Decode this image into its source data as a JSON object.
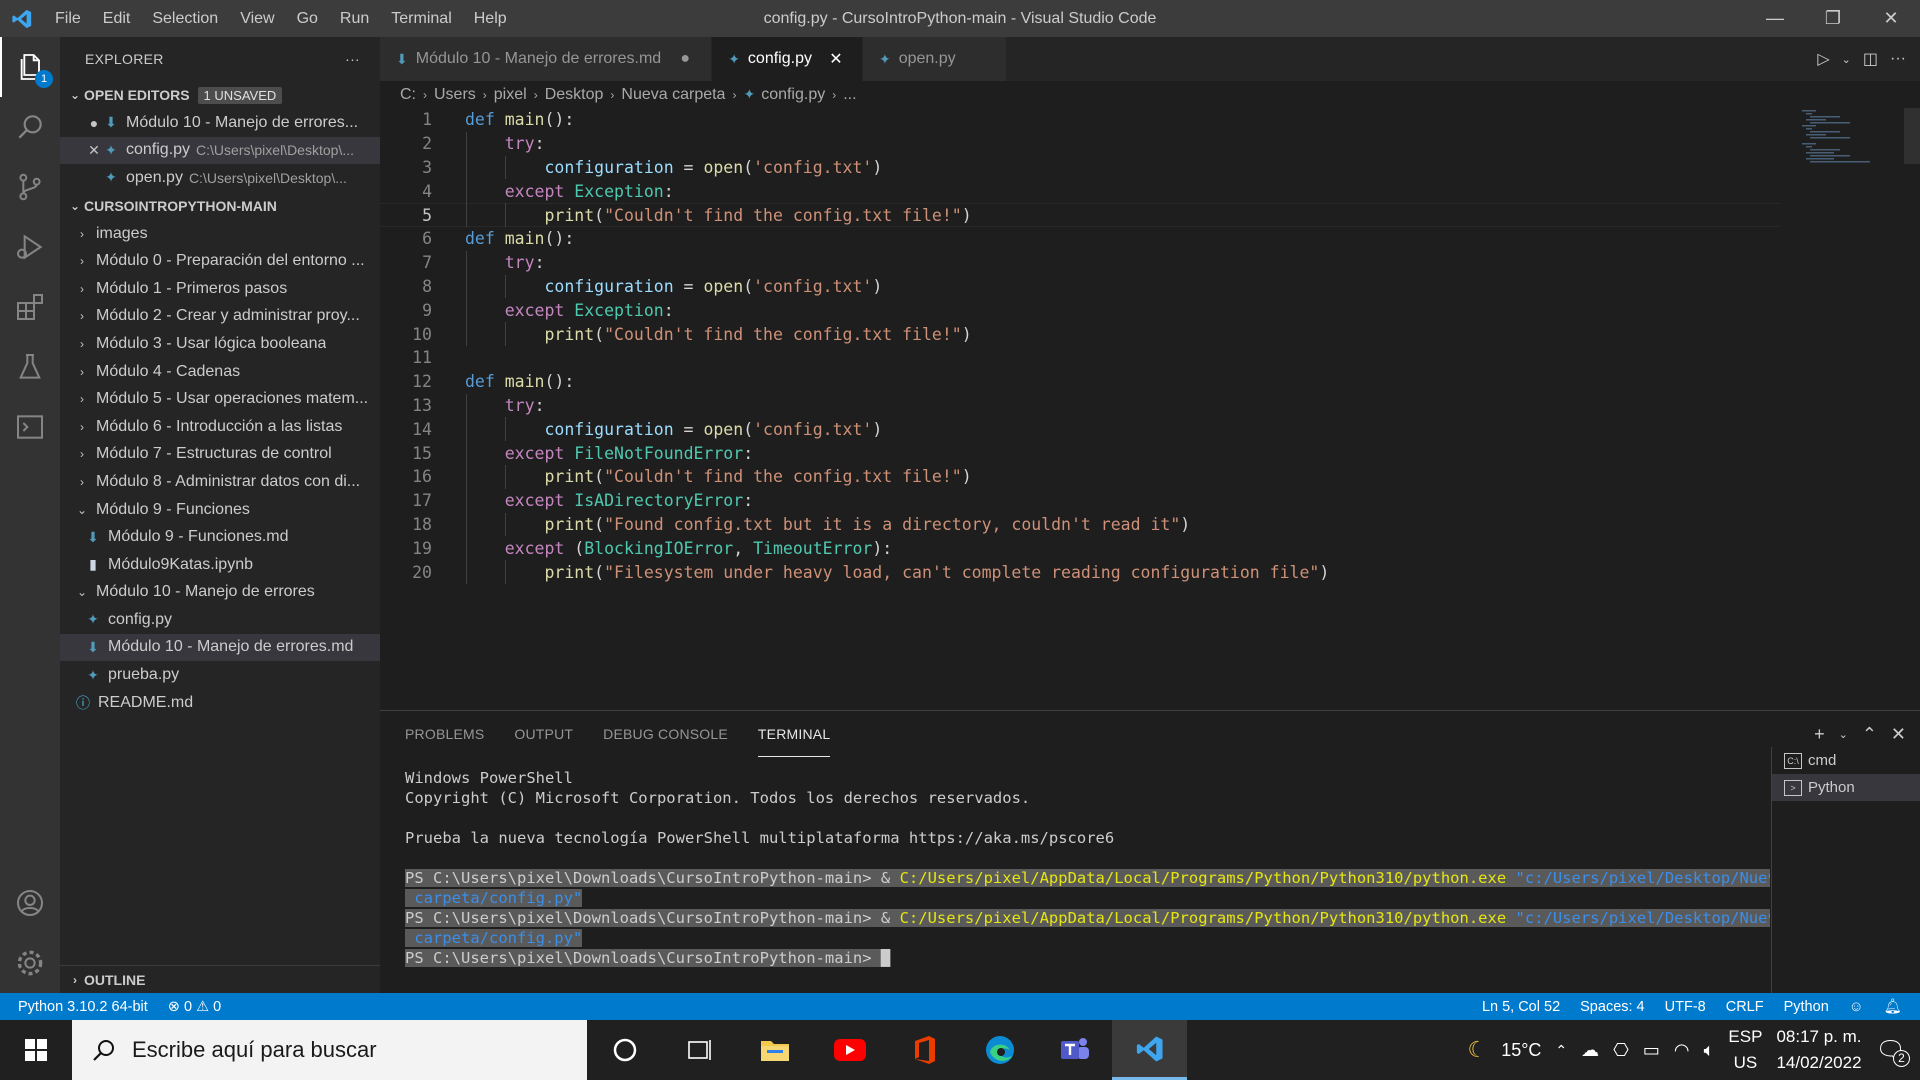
{
  "window": {
    "title": "config.py - CursoIntroPython-main - Visual Studio Code",
    "menu": [
      "File",
      "Edit",
      "Selection",
      "View",
      "Go",
      "Run",
      "Terminal",
      "Help"
    ],
    "controls": {
      "minimize": "—",
      "restore": "❐",
      "close": "✕"
    }
  },
  "activity": {
    "explorer_badge": "1"
  },
  "sidebar": {
    "header": "EXPLORER",
    "header_more": "···",
    "open_editors": {
      "label": "OPEN EDITORS",
      "badge": "1 UNSAVED",
      "items": [
        {
          "marker": "●",
          "name": "Módulo 10 - Manejo de errores...",
          "path": "",
          "icon": "markdown-icon"
        },
        {
          "marker": "✕",
          "name": "config.py",
          "path": "C:\\Users\\pixel\\Desktop\\...",
          "icon": "python-icon"
        },
        {
          "marker": "",
          "name": "open.py",
          "path": "C:\\Users\\pixel\\Desktop\\...",
          "icon": "python-icon"
        }
      ]
    },
    "project": {
      "label": "CURSOINTROPYTHON-MAIN",
      "items": [
        {
          "type": "folder",
          "depth": 0,
          "open": false,
          "name": "images"
        },
        {
          "type": "folder",
          "depth": 0,
          "open": false,
          "name": "Módulo 0 - Preparación del entorno ..."
        },
        {
          "type": "folder",
          "depth": 0,
          "open": false,
          "name": "Módulo 1 - Primeros pasos"
        },
        {
          "type": "folder",
          "depth": 0,
          "open": false,
          "name": "Módulo 2 - Crear y administrar proy..."
        },
        {
          "type": "folder",
          "depth": 0,
          "open": false,
          "name": "Módulo 3 - Usar lógica booleana"
        },
        {
          "type": "folder",
          "depth": 0,
          "open": false,
          "name": "Módulo 4 - Cadenas"
        },
        {
          "type": "folder",
          "depth": 0,
          "open": false,
          "name": "Módulo 5 - Usar operaciones matem..."
        },
        {
          "type": "folder",
          "depth": 0,
          "open": false,
          "name": "Módulo 6 - Introducción a las listas"
        },
        {
          "type": "folder",
          "depth": 0,
          "open": false,
          "name": "Módulo 7 - Estructuras de control"
        },
        {
          "type": "folder",
          "depth": 0,
          "open": false,
          "name": "Módulo 8 - Administrar datos con di..."
        },
        {
          "type": "folder",
          "depth": 0,
          "open": true,
          "name": "Módulo 9 - Funciones"
        },
        {
          "type": "md",
          "depth": 1,
          "name": "Módulo 9 - Funciones.md"
        },
        {
          "type": "nb",
          "depth": 1,
          "name": "Módulo9Katas.ipynb"
        },
        {
          "type": "folder",
          "depth": 0,
          "open": true,
          "name": "Módulo 10 - Manejo de errores"
        },
        {
          "type": "py",
          "depth": 1,
          "name": "config.py"
        },
        {
          "type": "md",
          "depth": 1,
          "name": "Módulo 10 - Manejo de errores.md",
          "selected": true
        },
        {
          "type": "py",
          "depth": 1,
          "name": "prueba.py"
        },
        {
          "type": "info",
          "depth": 0,
          "name": "README.md"
        }
      ]
    },
    "outline_label": "OUTLINE"
  },
  "tabs": [
    {
      "name": "Módulo 10 - Manejo de errores.md",
      "icon": "markdown-icon",
      "ctl": "●",
      "active": false
    },
    {
      "name": "config.py",
      "icon": "python-icon",
      "ctl": "✕",
      "active": true
    },
    {
      "name": "open.py",
      "icon": "python-icon",
      "ctl": "",
      "active": false
    }
  ],
  "breadcrumb": [
    "C:",
    "Users",
    "pixel",
    "Desktop",
    "Nueva carpeta",
    "config.py",
    "..."
  ],
  "editor": {
    "current_line": 5,
    "lines": [
      [
        [
          "kwd",
          "def "
        ],
        [
          "fn",
          "main"
        ],
        [
          "",
          "():"
        ]
      ],
      [
        [
          "",
          "    "
        ],
        [
          "kw",
          "try"
        ],
        [
          "",
          ":"
        ]
      ],
      [
        [
          "",
          "        "
        ],
        [
          "var",
          "configuration"
        ],
        [
          "",
          " = "
        ],
        [
          "fn",
          "open"
        ],
        [
          "",
          "("
        ],
        [
          "str",
          "'config.txt'"
        ],
        [
          "",
          ")"
        ]
      ],
      [
        [
          "",
          "    "
        ],
        [
          "kw",
          "except "
        ],
        [
          "cls",
          "Exception"
        ],
        [
          "",
          ":"
        ]
      ],
      [
        [
          "",
          "        "
        ],
        [
          "fn",
          "print"
        ],
        [
          "",
          "("
        ],
        [
          "str",
          "\"Couldn't find the config.txt file!\""
        ],
        [
          "",
          ")"
        ]
      ],
      [
        [
          "kwd",
          "def "
        ],
        [
          "fn",
          "main"
        ],
        [
          "",
          "():"
        ]
      ],
      [
        [
          "",
          "    "
        ],
        [
          "kw",
          "try"
        ],
        [
          "",
          ":"
        ]
      ],
      [
        [
          "",
          "        "
        ],
        [
          "var",
          "configuration"
        ],
        [
          "",
          " = "
        ],
        [
          "fn",
          "open"
        ],
        [
          "",
          "("
        ],
        [
          "str",
          "'config.txt'"
        ],
        [
          "",
          ")"
        ]
      ],
      [
        [
          "",
          "    "
        ],
        [
          "kw",
          "except "
        ],
        [
          "cls",
          "Exception"
        ],
        [
          "",
          ":"
        ]
      ],
      [
        [
          "",
          "        "
        ],
        [
          "fn",
          "print"
        ],
        [
          "",
          "("
        ],
        [
          "str",
          "\"Couldn't find the config.txt file!\""
        ],
        [
          "",
          ")"
        ]
      ],
      [],
      [
        [
          "kwd",
          "def "
        ],
        [
          "fn",
          "main"
        ],
        [
          "",
          "():"
        ]
      ],
      [
        [
          "",
          "    "
        ],
        [
          "kw",
          "try"
        ],
        [
          "",
          ":"
        ]
      ],
      [
        [
          "",
          "        "
        ],
        [
          "var",
          "configuration"
        ],
        [
          "",
          " = "
        ],
        [
          "fn",
          "open"
        ],
        [
          "",
          "("
        ],
        [
          "str",
          "'config.txt'"
        ],
        [
          "",
          ")"
        ]
      ],
      [
        [
          "",
          "    "
        ],
        [
          "kw",
          "except "
        ],
        [
          "cls",
          "FileNotFoundError"
        ],
        [
          "",
          ":"
        ]
      ],
      [
        [
          "",
          "        "
        ],
        [
          "fn",
          "print"
        ],
        [
          "",
          "("
        ],
        [
          "str",
          "\"Couldn't find the config.txt file!\""
        ],
        [
          "",
          ")"
        ]
      ],
      [
        [
          "",
          "    "
        ],
        [
          "kw",
          "except "
        ],
        [
          "cls",
          "IsADirectoryError"
        ],
        [
          "",
          ":"
        ]
      ],
      [
        [
          "",
          "        "
        ],
        [
          "fn",
          "print"
        ],
        [
          "",
          "("
        ],
        [
          "str",
          "\"Found config.txt but it is a directory, couldn't read it\""
        ],
        [
          "",
          ")"
        ]
      ],
      [
        [
          "",
          "    "
        ],
        [
          "kw",
          "except "
        ],
        [
          "",
          "("
        ],
        [
          "cls",
          "BlockingIOError"
        ],
        [
          "",
          ", "
        ],
        [
          "cls",
          "TimeoutError"
        ],
        [
          "",
          "):"
        ]
      ],
      [
        [
          "",
          "        "
        ],
        [
          "fn",
          "print"
        ],
        [
          "",
          "("
        ],
        [
          "str",
          "\"Filesystem under heavy load, can't complete reading configuration file\""
        ],
        [
          "",
          ")"
        ]
      ]
    ]
  },
  "panel": {
    "tabs": [
      "PROBLEMS",
      "OUTPUT",
      "DEBUG CONSOLE",
      "TERMINAL"
    ],
    "active_tab": "TERMINAL",
    "terminal_lines": [
      [
        [
          "",
          "Windows PowerShell"
        ]
      ],
      [
        [
          "",
          "Copyright (C) Microsoft Corporation. Todos los derechos reservados."
        ]
      ],
      [
        [
          "",
          ""
        ]
      ],
      [
        [
          "",
          "Prueba la nueva tecnología PowerShell multiplataforma https://aka.ms/pscore6"
        ]
      ],
      [
        [
          "",
          ""
        ]
      ],
      [
        [
          "s",
          "PS C:\\Users\\pixel\\Downloads\\CursoIntroPython-main> & "
        ],
        [
          "sy",
          "C:/Users/pixel/AppData/Local/Programs/Python/Python310/python.exe"
        ],
        [
          "s",
          " "
        ],
        [
          "sc",
          "\"c:/Users/pixel/Desktop/Nueva"
        ]
      ],
      [
        [
          "sc",
          " carpeta/config.py\""
        ]
      ],
      [
        [
          "s",
          "PS C:\\Users\\pixel\\Downloads\\CursoIntroPython-main> & "
        ],
        [
          "sy",
          "C:/Users/pixel/AppData/Local/Programs/Python/Python310/python.exe"
        ],
        [
          "s",
          " "
        ],
        [
          "sc",
          "\"c:/Users/pixel/Desktop/Nueva"
        ]
      ],
      [
        [
          "sc",
          " carpeta/config.py\""
        ]
      ],
      [
        [
          "s",
          "PS C:\\Users\\pixel\\Downloads\\CursoIntroPython-main> "
        ],
        [
          "cursor",
          "█"
        ]
      ]
    ],
    "terminals": [
      {
        "name": "cmd",
        "icon": "C:\\",
        "active": false
      },
      {
        "name": "Python",
        "icon": ">",
        "active": true
      }
    ]
  },
  "status": {
    "interpreter": "Python 3.10.2 64-bit",
    "errors": "⊗ 0",
    "warnings": "⚠ 0",
    "position": "Ln 5, Col 52",
    "spaces": "Spaces: 4",
    "encoding": "UTF-8",
    "eol": "CRLF",
    "language": "Python"
  },
  "taskbar": {
    "search_placeholder": "Escribe aquí para buscar",
    "temperature": "15°C",
    "lang_top": "ESP",
    "lang_bottom": "US",
    "time": "08:17 p. m.",
    "date": "14/02/2022",
    "notifications": "2"
  },
  "colors": {
    "accent": "#007acc",
    "statusbar": "#007acc"
  }
}
